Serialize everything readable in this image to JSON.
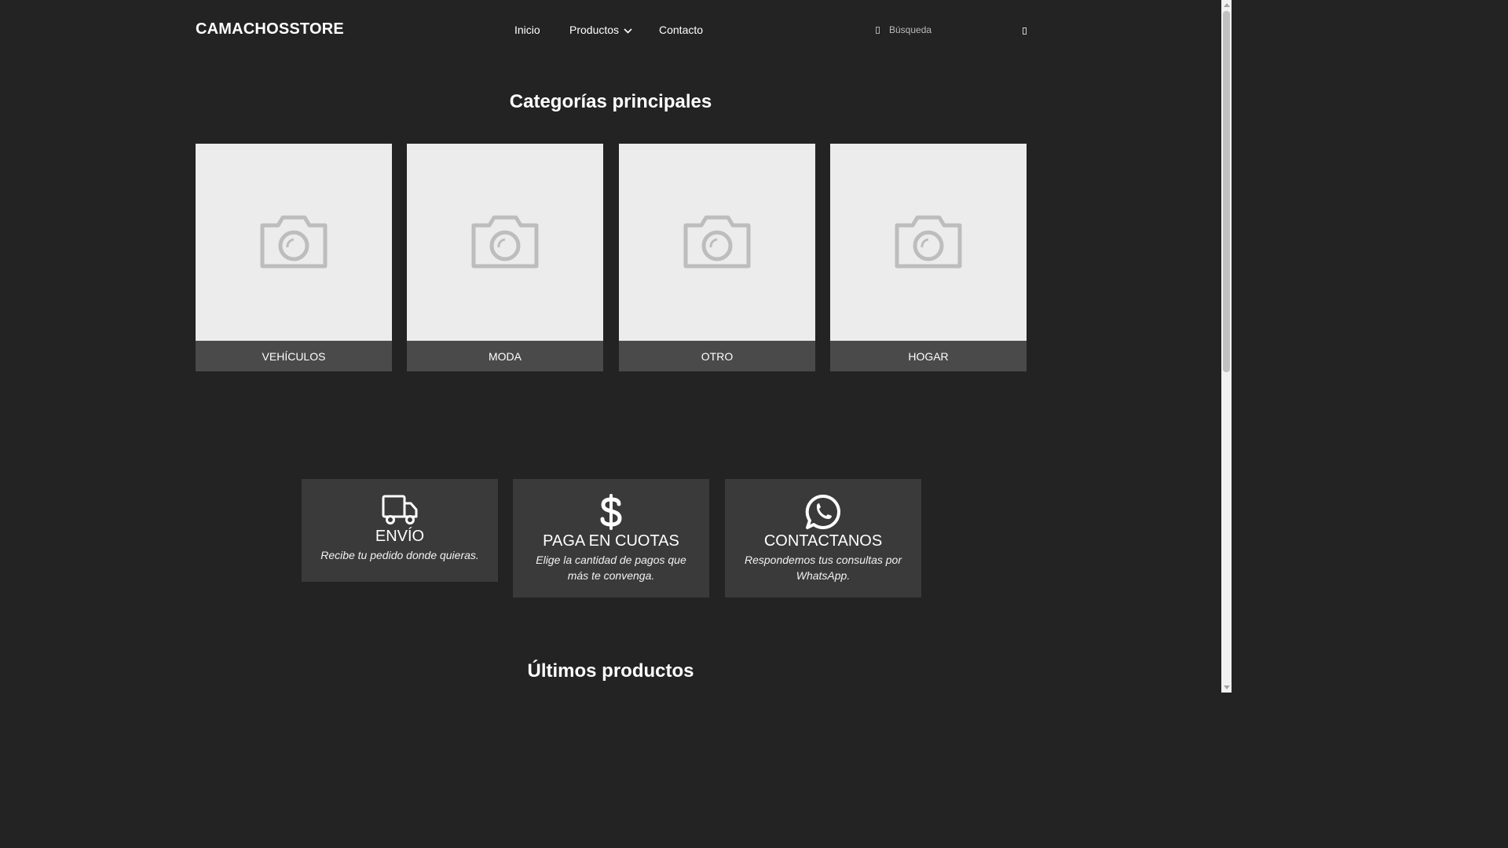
{
  "header": {
    "logo": "CAMACHOSSTORE",
    "nav": {
      "inicio": "Inicio",
      "productos": "Productos",
      "contacto": "Contacto"
    },
    "search_placeholder": "Búsqueda"
  },
  "categories": {
    "title": "Categorías principales",
    "items": [
      {
        "label": "VEHÍCULOS",
        "icon": "camera-placeholder-icon"
      },
      {
        "label": "MODA",
        "icon": "camera-placeholder-icon"
      },
      {
        "label": "OTRO",
        "icon": "camera-placeholder-icon"
      },
      {
        "label": "HOGAR",
        "icon": "camera-placeholder-icon"
      }
    ]
  },
  "features": [
    {
      "title": "ENVÍO",
      "text": "Recibe tu pedido donde quieras.",
      "icon": "truck-icon"
    },
    {
      "title": "PAGA EN CUOTAS",
      "text": "Elige la cantidad de pagos que más te convenga.",
      "icon": "dollar-icon"
    },
    {
      "title": "CONTACTANOS",
      "text": "Respondemos tus consultas por WhatsApp.",
      "icon": "whatsapp-icon"
    }
  ],
  "latest": {
    "title": "Últimos productos"
  },
  "colors": {
    "background": "#232323",
    "card_placeholder": "#ececec",
    "card_label": "#4a4a4a",
    "feature_card": "#3a3a3a",
    "icon_gray": "#bdbdbd"
  }
}
